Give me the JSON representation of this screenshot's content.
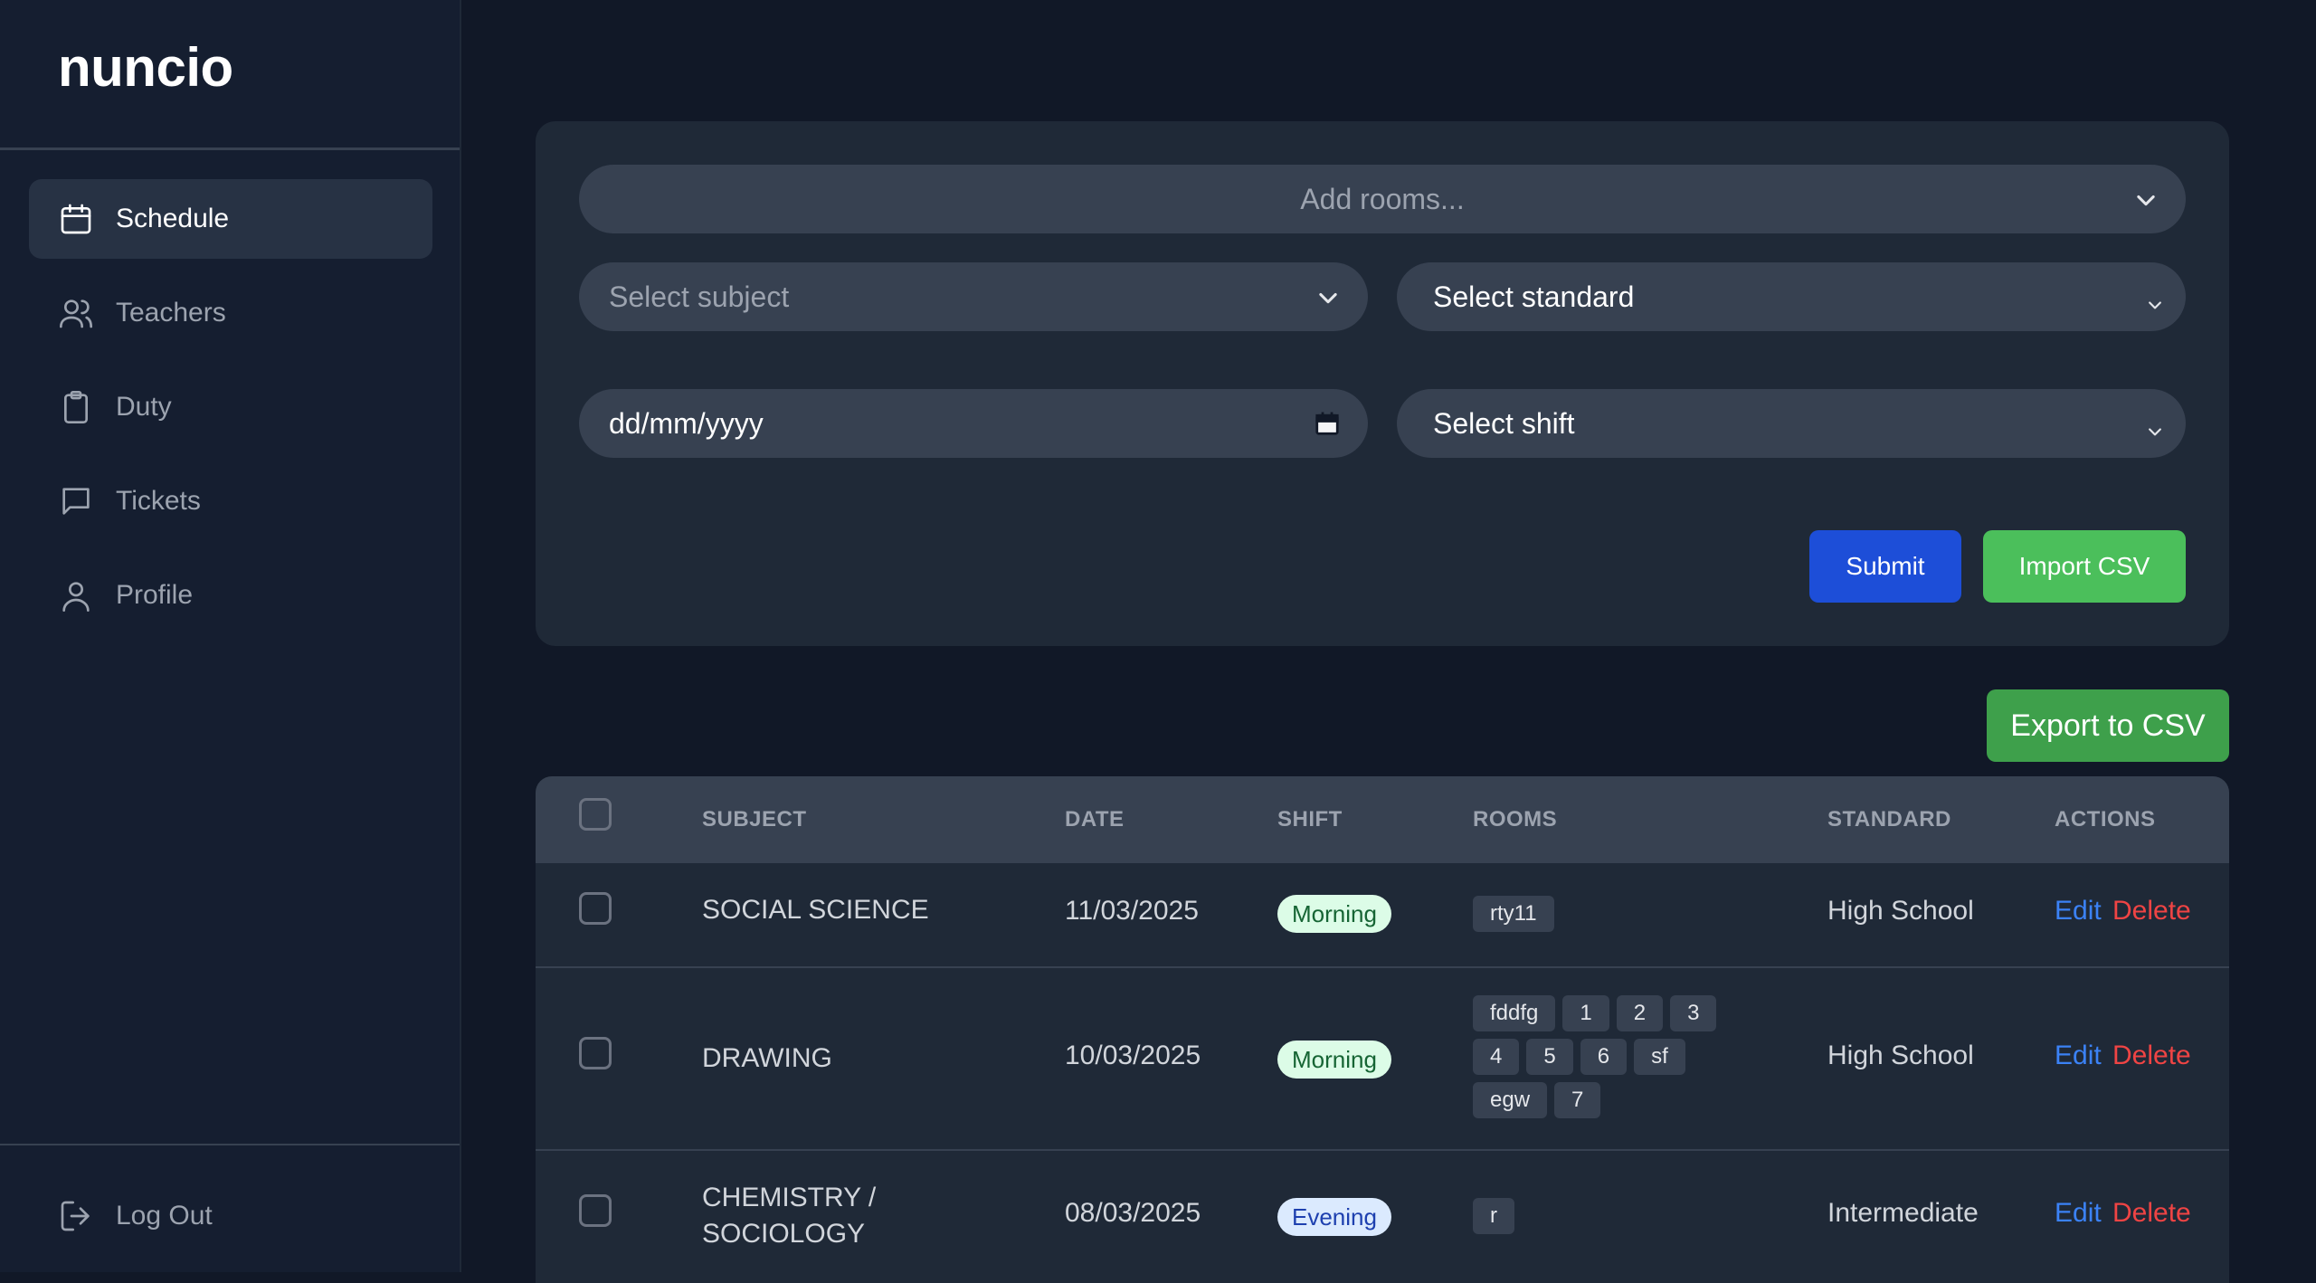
{
  "app": {
    "name": "nuncio"
  },
  "sidebar": {
    "items": [
      {
        "label": "Schedule",
        "icon": "calendar-icon",
        "active": true
      },
      {
        "label": "Teachers",
        "icon": "users-icon"
      },
      {
        "label": "Duty",
        "icon": "clipboard-icon"
      },
      {
        "label": "Tickets",
        "icon": "chat-icon"
      },
      {
        "label": "Profile",
        "icon": "user-icon"
      }
    ],
    "logout": {
      "label": "Log Out",
      "icon": "logout-icon"
    }
  },
  "form": {
    "rooms_placeholder": "Add rooms...",
    "subject_placeholder": "Select subject",
    "standard_value": "Select standard",
    "date_placeholder": "dd/mm/yyyy",
    "shift_value": "Select shift",
    "submit_label": "Submit",
    "import_label": "Import CSV"
  },
  "export_label": "Export to CSV",
  "table": {
    "columns": [
      "SUBJECT",
      "DATE",
      "SHIFT",
      "ROOMS",
      "STANDARD",
      "ACTIONS"
    ],
    "rows": [
      {
        "subject": "SOCIAL SCIENCE",
        "date": "11/03/2025",
        "shift": "Morning",
        "rooms": [
          "rty11"
        ],
        "standard": "High School"
      },
      {
        "subject": "DRAWING",
        "date": "10/03/2025",
        "shift": "Morning",
        "rooms": [
          "fddfg",
          "1",
          "2",
          "3",
          "4",
          "5",
          "6",
          "sf",
          "egw",
          "7"
        ],
        "standard": "High School"
      },
      {
        "subject": "CHEMISTRY / SOCIOLOGY",
        "date": "08/03/2025",
        "shift": "Evening",
        "rooms": [
          "r"
        ],
        "standard": "Intermediate"
      }
    ],
    "edit_label": "Edit",
    "delete_label": "Delete"
  },
  "colors": {
    "background": "#111827",
    "sidebar": "#151e30",
    "card": "#1f2937",
    "submit": "#1d4ed8",
    "import": "#4bbf5b",
    "export": "#3ea04b",
    "edit": "#3b82f6",
    "delete": "#ef4444"
  }
}
